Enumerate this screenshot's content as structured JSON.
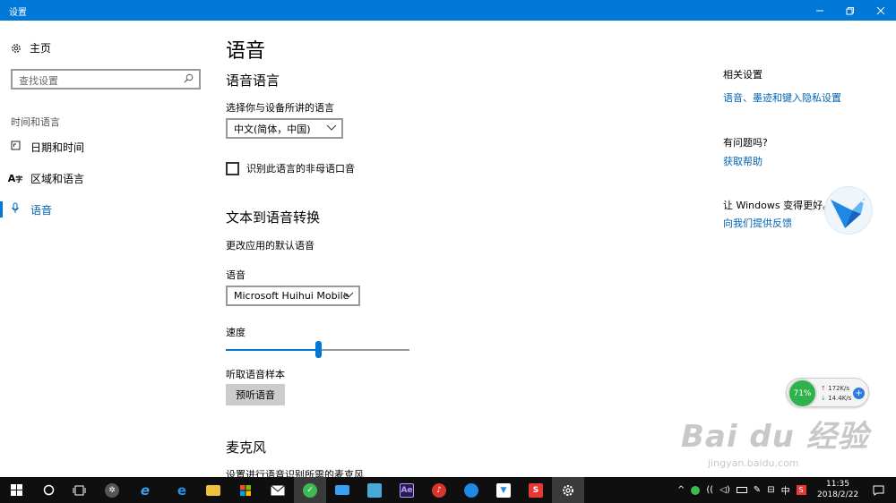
{
  "window": {
    "title": "设置",
    "min_icon": "minimize-icon",
    "max_icon": "maximize-icon",
    "close_icon": "close-icon"
  },
  "sidebar": {
    "home_label": "主页",
    "search_placeholder": "查找设置",
    "section_title": "时间和语言",
    "items": [
      {
        "label": "日期和时间",
        "icon": "calendar-icon"
      },
      {
        "label": "区域和语言",
        "icon": "language-icon"
      },
      {
        "label": "语音",
        "icon": "microphone-icon",
        "active": true
      }
    ]
  },
  "main": {
    "page_title": "语音",
    "speech_lang": {
      "heading": "语音语言",
      "select_label": "选择你与设备所讲的语言",
      "selected_value": "中文(简体，中国)",
      "checkbox_label": "识别此语言的非母语口音",
      "checkbox_checked": false
    },
    "tts": {
      "heading": "文本到语音转换",
      "description": "更改应用的默认语音",
      "voice_label": "语音",
      "voice_value": "Microsoft Huihui Mobile",
      "speed_label": "速度",
      "speed_fraction": 0.5,
      "sample_label": "听取语音样本",
      "preview_button": "预听语音"
    },
    "mic": {
      "heading": "麦克风",
      "description": "设置进行语音识别所需的麦克风"
    }
  },
  "right": {
    "related_title": "相关设置",
    "related_link": "语音、墨迹和键入隐私设置",
    "question_title": "有问题吗?",
    "help_link": "获取帮助",
    "feedback_title": "让 Windows 变得更好。",
    "feedback_link": "向我们提供反馈"
  },
  "net_widget": {
    "percent": "71%",
    "upload": "172K/s",
    "download": "14.4K/s"
  },
  "watermark": {
    "brand": "Bai du 经验",
    "url": "jingyan.baidu.com"
  },
  "taskbar": {
    "apps": [
      "start-icon",
      "cortana-icon",
      "task-view-icon",
      "fan-app-icon",
      "ie-icon",
      "edge-icon",
      "explorer-icon",
      "store-icon",
      "mail-icon",
      "app-green-icon",
      "laptop-app-icon",
      "remote-app-icon",
      "after-effects-icon",
      "netease-music-icon",
      "qq-browser-icon",
      "bird-app-icon",
      "sogou-icon",
      "settings-icon"
    ],
    "ae_label": "Ae",
    "ime": "中",
    "ime_s": "S",
    "time": "11:35",
    "date": "2018/2/22"
  },
  "colors": {
    "accent": "#0078d7",
    "link": "#0063b1",
    "taskbar": "#0f0f0f"
  }
}
